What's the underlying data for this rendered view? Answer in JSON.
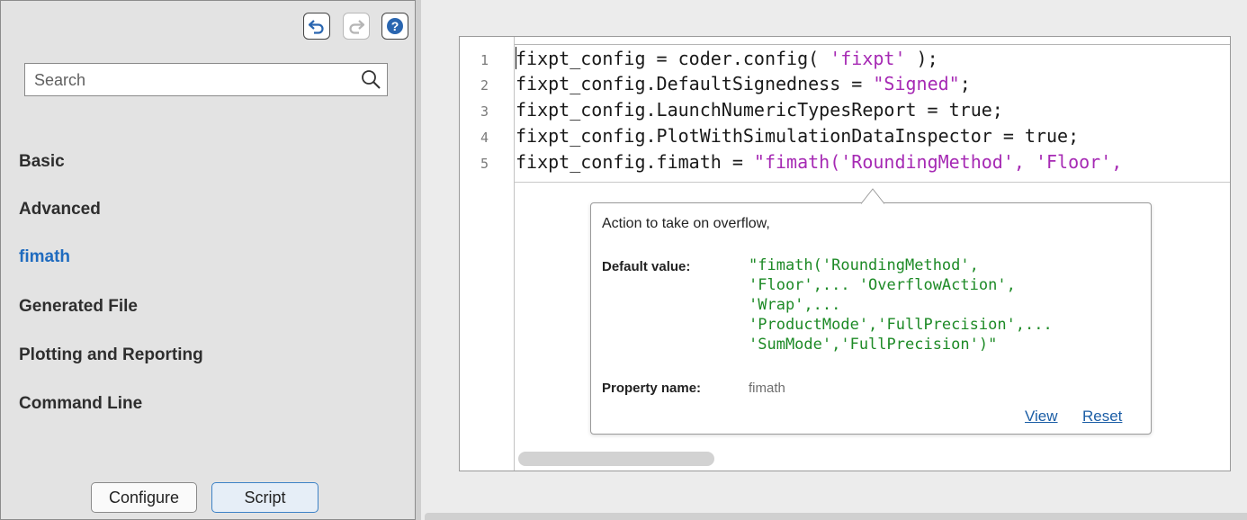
{
  "toolbar": {
    "undo_icon": "undo-icon",
    "redo_icon": "redo-icon",
    "help_icon": "help-icon"
  },
  "search": {
    "placeholder": "Search",
    "value": ""
  },
  "sidebar": {
    "items": [
      {
        "label": "Basic",
        "active": false
      },
      {
        "label": "Advanced",
        "active": false
      },
      {
        "label": "fimath",
        "active": true
      },
      {
        "label": "Generated File",
        "active": false
      },
      {
        "label": "Plotting and Reporting",
        "active": false
      },
      {
        "label": "Command Line",
        "active": false
      }
    ]
  },
  "footer": {
    "configure_label": "Configure",
    "script_label": "Script",
    "selected": "Script"
  },
  "editor": {
    "lines": [
      {
        "num": "1",
        "code": "fixpt_config = coder.config( ",
        "str": "'fixpt'",
        "tail": " );"
      },
      {
        "num": "2",
        "code": "fixpt_config.DefaultSignedness = ",
        "str": "\"Signed\"",
        "tail": ";"
      },
      {
        "num": "3",
        "code": "fixpt_config.LaunchNumericTypesReport = true;",
        "str": "",
        "tail": ""
      },
      {
        "num": "4",
        "code": "fixpt_config.PlotWithSimulationDataInspector = true;",
        "str": "",
        "tail": ""
      },
      {
        "num": "5",
        "code": "fixpt_config.fimath = ",
        "str": "\"fimath('RoundingMethod', 'Floor',",
        "tail": ""
      }
    ]
  },
  "tooltip": {
    "description": "Action to take on overflow,",
    "default_label": "Default value:",
    "default_value": "\"fimath('RoundingMethod',\n'Floor',... 'OverflowAction',\n'Wrap',...\n'ProductMode','FullPrecision',...\n'SumMode','FullPrecision')\"",
    "property_label": "Property name:",
    "property_value": "fimath",
    "view_link": "View",
    "reset_link": "Reset"
  },
  "colors": {
    "accent": "#1f6bbf",
    "string": "#a62ab4",
    "default_value": "#1d8a26",
    "link": "#1c5ea6"
  }
}
